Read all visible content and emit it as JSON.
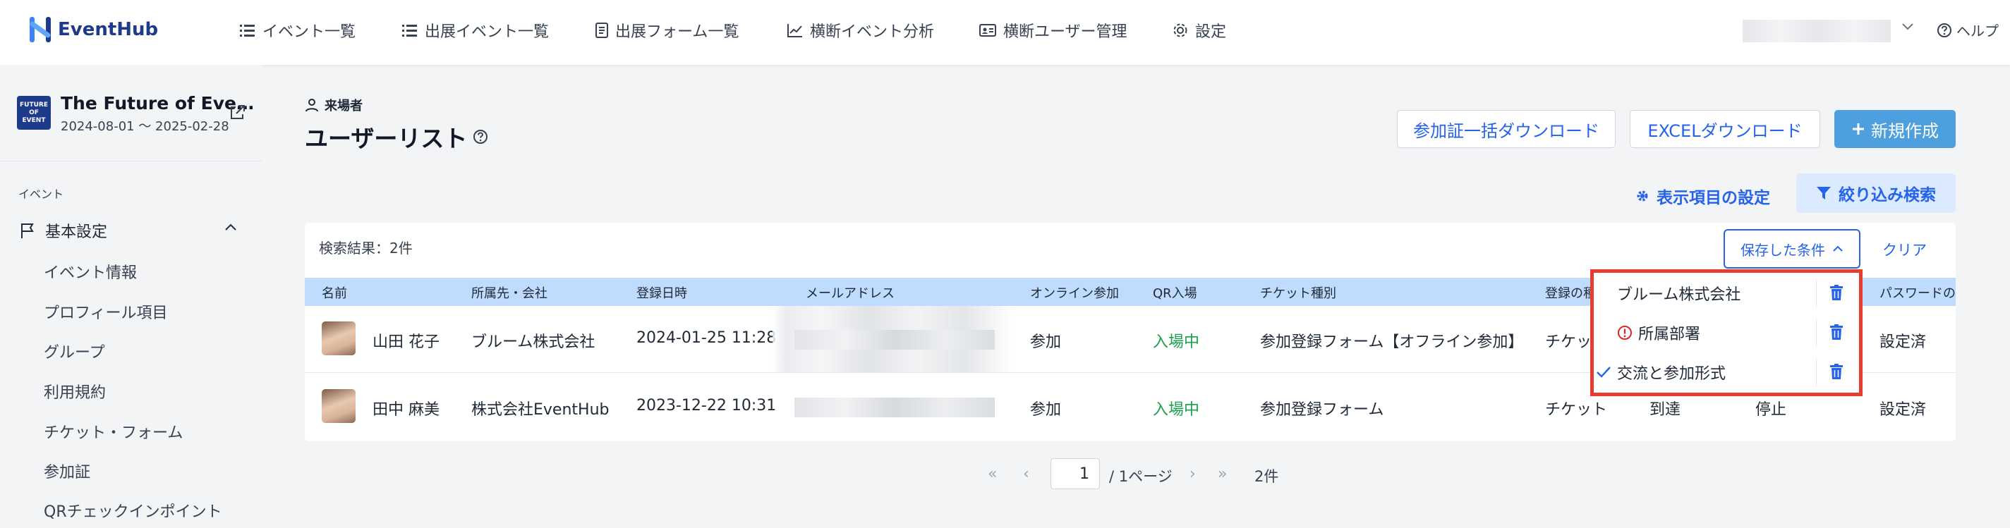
{
  "header": {
    "logo_text": "EventHub",
    "nav": [
      "イベント一覧",
      "出展イベント一覧",
      "出展フォーム一覧",
      "横断イベント分析",
      "横断ユーザー管理",
      "設定"
    ],
    "help": "ヘルプ"
  },
  "sidebar": {
    "event_title": "The Future of Eve…",
    "event_thumb": "FUTURE OF EVENT",
    "event_dates": "2024-08-01 〜 2025-02-28",
    "section": "イベント",
    "group": "基本設定",
    "items": [
      "イベント情報",
      "プロフィール項目",
      "グループ",
      "利用規約",
      "チケット・フォーム",
      "参加証",
      "QRチェックインポイント"
    ]
  },
  "page": {
    "breadcrumb": "来場者",
    "title": "ユーザーリスト",
    "buttons": {
      "bulk_download": "参加証一括ダウンロード",
      "excel": "EXCELダウンロード",
      "new": "新規作成"
    },
    "display_settings": "表示項目の設定",
    "filter": "絞り込み検索",
    "result_count": "検索結果：2件",
    "saved_conditions": "保存した条件",
    "clear": "クリア"
  },
  "table": {
    "columns": [
      "名前",
      "所属先・会社",
      "登録日時",
      "メールアドレス",
      "オンライン参加",
      "QR入場",
      "チケット種別",
      "登録の種",
      "パスワードの"
    ],
    "rows": [
      {
        "name": "山田 花子",
        "company": "ブルーム株式会社",
        "registered": "2024-01-25 11:28",
        "online": "参加",
        "qr": "入場中",
        "ticket": "参加登録フォーム【オフライン参加】",
        "reg_type": "チケット",
        "password": "設定済"
      },
      {
        "name": "田中 麻美",
        "company": "株式会社EventHub",
        "registered": "2023-12-22 10:31",
        "online": "参加",
        "qr": "入場中",
        "ticket": "参加登録フォーム",
        "reg_type": "チケット",
        "status1": "到達",
        "status2": "停止",
        "password": "設定済"
      }
    ]
  },
  "saved_dropdown": {
    "items": [
      {
        "label": "ブルーム株式会社",
        "state": "normal"
      },
      {
        "label": "所属部署",
        "state": "error"
      },
      {
        "label": "交流と参加形式",
        "state": "selected"
      }
    ]
  },
  "pagination": {
    "current": "1",
    "total_label": "/ 1ページ",
    "count": "2件"
  },
  "colors": {
    "accent": "#2563eb",
    "primary_button": "#4da0dd",
    "header_row": "#bfdbfe",
    "highlight": "#e53e2e",
    "status_green": "#16a34a"
  }
}
